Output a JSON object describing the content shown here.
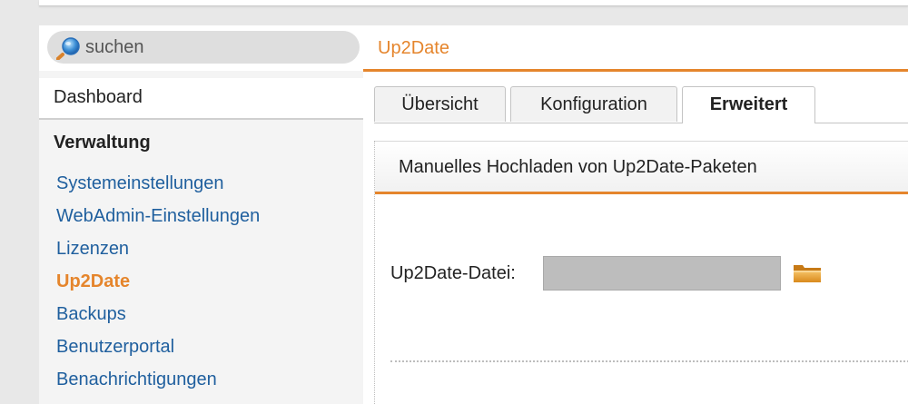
{
  "search": {
    "placeholder": "suchen"
  },
  "sidebar": {
    "dashboard": "Dashboard",
    "section": "Verwaltung",
    "items": [
      {
        "label": "Systemeinstellungen"
      },
      {
        "label": "WebAdmin-Einstellungen"
      },
      {
        "label": "Lizenzen"
      },
      {
        "label": "Up2Date"
      },
      {
        "label": "Backups"
      },
      {
        "label": "Benutzerportal"
      },
      {
        "label": "Benachrichtigungen"
      }
    ],
    "active_item": "Up2Date"
  },
  "main": {
    "title": "Up2Date",
    "tabs": [
      {
        "label": "Übersicht"
      },
      {
        "label": "Konfiguration"
      },
      {
        "label": "Erweitert"
      }
    ],
    "active_tab": "Erweitert",
    "panel": {
      "title": "Manuelles Hochladen von Up2Date-Paketen",
      "field_label": "Up2Date-Datei:",
      "file_value": ""
    }
  },
  "colors": {
    "accent": "#e5852c",
    "link": "#1f5f9e",
    "sidebar_bg": "#f4f4f4",
    "input_bg": "#bdbdbd"
  },
  "icons": {
    "search": "search-icon",
    "folder": "folder-icon"
  }
}
